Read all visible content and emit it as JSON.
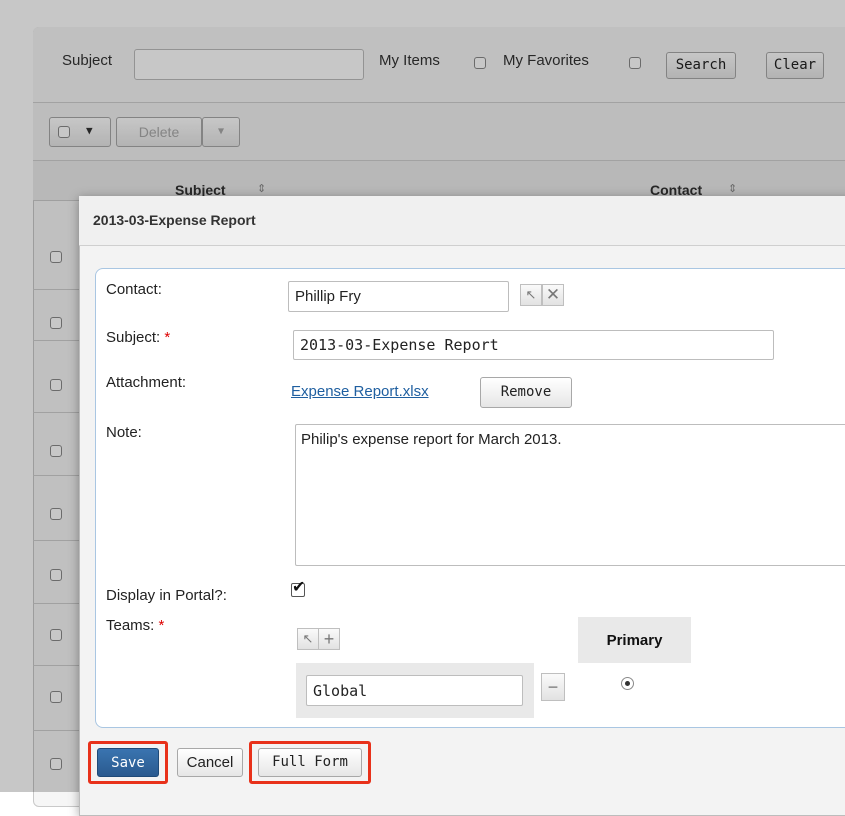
{
  "search": {
    "subject_label": "Subject",
    "subject_value": "",
    "my_items_label": "My Items",
    "my_favorites_label": "My Favorites",
    "search_button": "Search",
    "clear_button": "Clear"
  },
  "toolbar": {
    "delete_label": "Delete"
  },
  "list": {
    "columns": [
      "Subject",
      "Contact"
    ]
  },
  "modal": {
    "title": "2013-03-Expense Report",
    "fields": {
      "contact_label": "Contact:",
      "contact_value": "Phillip Fry",
      "subject_label": "Subject:",
      "subject_required": "*",
      "subject_value": "2013-03-Expense Report",
      "attachment_label": "Attachment:",
      "attachment_link": "Expense Report.xlsx",
      "remove_button": "Remove",
      "note_label": "Note:",
      "note_value": "Philip's expense report for March 2013.",
      "portal_label": "Display in Portal?:",
      "portal_checked": true,
      "teams_label": "Teams:",
      "teams_required": "*",
      "primary_header": "Primary",
      "team_value": "Global"
    },
    "buttons": {
      "save": "Save",
      "cancel": "Cancel",
      "full_form": "Full Form"
    }
  },
  "colors": {
    "save_bg": "#2f6aa5",
    "highlight": "#e8311a",
    "required": "#dd0000",
    "link": "#1f5fa0"
  }
}
